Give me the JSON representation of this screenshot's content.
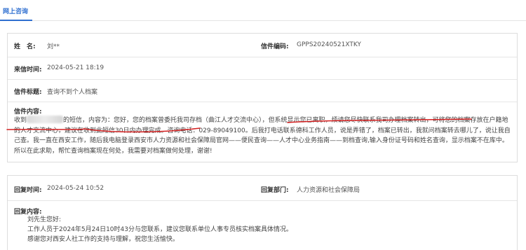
{
  "tab": {
    "label": "网上咨询"
  },
  "letter": {
    "name_label": "姓　名:",
    "name_value": "刘**",
    "code_label": "信件编码:",
    "code_value": "GPPS20240521XTKY",
    "time_label": "来信时间:",
    "time_value": "2024-05-21 18:19",
    "title_label": "信件标题:",
    "title_value": "查询不到个人档案",
    "content_label": "信件内容:",
    "content_prefix": "收到",
    "content_body": "的短信，内容为：您好，您的档案曾委托我司存档（曲江人才交流中心），但系统显示您已离职，烦请您尽快联系我司办理档案转出，可将您的档案存放在户籍地的人才交流中心，建议在收到此短信30日内办理完成。咨询电话：029-89049100。后我打电话联系德科工作人员，说是弄错了，档案已转出，我就问档案转去哪儿了，说让我自己查。我一直在西安工作，随后我电脑登录西安市人力资源和社会保障局官网——便民查询——人才中心业务指南——到档查询,输入身份证号码和姓名查询，显示档案不在库中。所以在此求助，帮忙查询档案现在何处，我需要对档案做何处理，谢谢!"
  },
  "reply": {
    "time_label": "回复时间:",
    "time_value": "2024-05-24 10:52",
    "dept_label": "回复部门:",
    "dept_value": "人力资源和社会保障局",
    "content_label": "回复内容:",
    "lines": [
      "刘先生您好:",
      "工作人员于2024年5月24日10时43分与您联系，建议您联系单位人事专员核实档案具体情况。",
      "感谢您对西安人社工作的支持与理解，祝您生活愉快。"
    ]
  },
  "colors": {
    "accent": "#2f6fd0",
    "annotation": "#d42020"
  }
}
